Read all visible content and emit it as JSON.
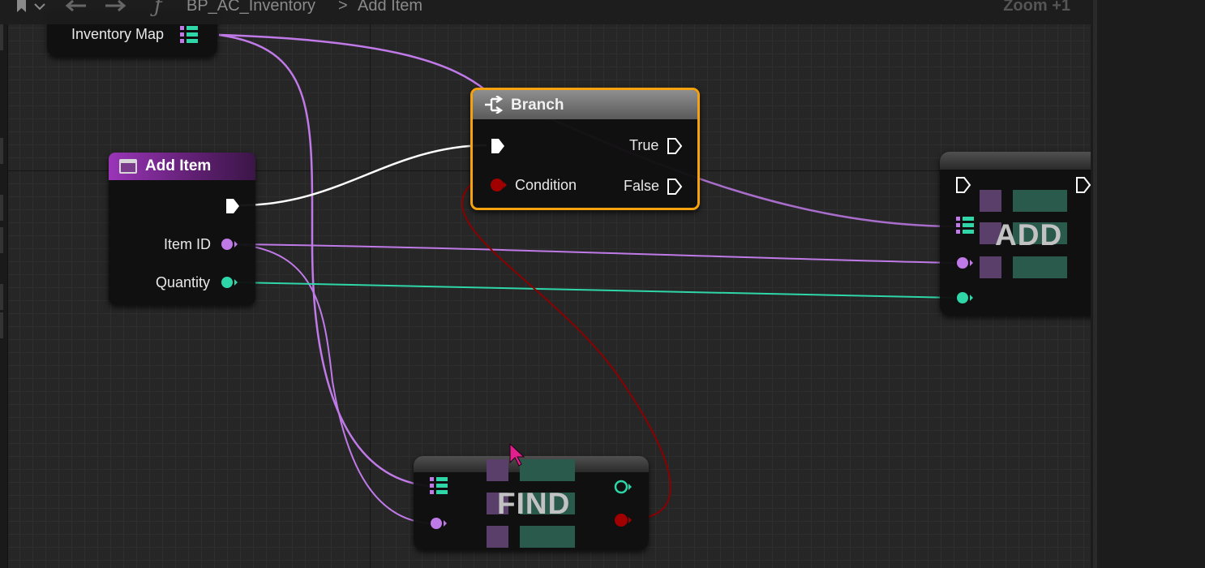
{
  "breadcrumb": {
    "blueprint": "BP_AC_Inventory",
    "separator": ">",
    "function": "Add Item"
  },
  "zoom": "Zoom +1",
  "nodes": {
    "inventory_map": {
      "label": "Inventory Map"
    },
    "add_item": {
      "title": "Add Item",
      "item_id": "Item ID",
      "quantity": "Quantity"
    },
    "branch": {
      "title": "Branch",
      "condition": "Condition",
      "true": "True",
      "false": "False"
    },
    "add": {
      "title": "ADD"
    },
    "find": {
      "title": "FIND"
    }
  },
  "icons": {
    "bookmark": "bookmark-icon",
    "back": "arrow-left-icon",
    "forward": "arrow-right-icon",
    "function": "function-icon",
    "branch": "branch-icon",
    "map_pin": "map-pin-icon"
  },
  "colors": {
    "map_wire": "#c07ae8",
    "integer_wire": "#2ed6a8",
    "exec_wire": "#ffffff",
    "bool_wire": "#8b0000",
    "selected_border": "#f5a20f",
    "add_item_header": "#6a1f7e"
  }
}
